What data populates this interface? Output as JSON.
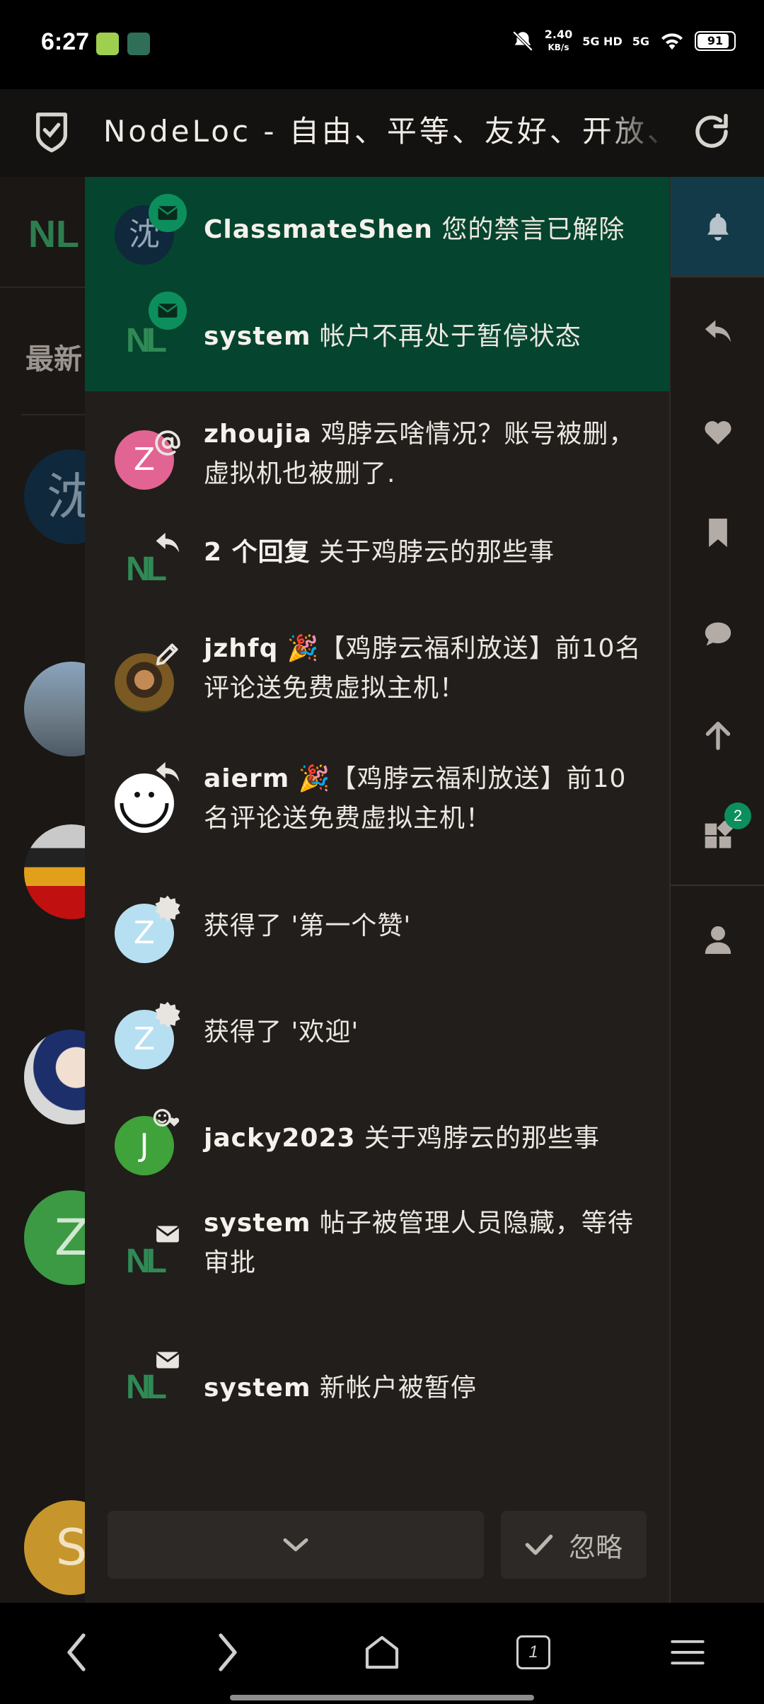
{
  "status_bar": {
    "time": "6:27",
    "speed_value": "2.40",
    "speed_unit": "KB/s",
    "net1": "5G HD",
    "net2": "5G",
    "battery": "91"
  },
  "browser": {
    "title": "NodeLoc - 自由、平等、友好、开放、有爱的社区"
  },
  "background_page": {
    "logo": "NL",
    "latest_label": "最新",
    "avatar_letters": [
      "沈",
      "Z",
      "S"
    ]
  },
  "notifications": [
    {
      "user": "ClassmateShen",
      "text": "您的禁言已解除",
      "kind": "envelope-icon",
      "unread": true,
      "avatar": "沈"
    },
    {
      "user": "system",
      "text": "帐户不再处于暂停状态",
      "kind": "envelope-icon",
      "unread": true,
      "avatar": "NL"
    },
    {
      "user": "zhoujia",
      "text": "鸡脖云啥情况？账号被删，虚拟机也被删了.",
      "kind": "at-icon",
      "unread": false,
      "avatar": "Z"
    },
    {
      "user": "2 个回复",
      "text": "关于鸡脖云的那些事",
      "kind": "reply-icon",
      "unread": false,
      "avatar": "NL"
    },
    {
      "user": "jzhfq",
      "text": "🎉【鸡脖云福利放送】前10名评论送免费虚拟主机！",
      "kind": "pencil-icon",
      "unread": false,
      "avatar": "photo"
    },
    {
      "user": "aierm",
      "text": "🎉【鸡脖云福利放送】前10名评论送免费虚拟主机！",
      "kind": "reply-icon",
      "unread": false,
      "avatar": "a"
    },
    {
      "user": "",
      "text": "获得了 '第一个赞'",
      "kind": "badge-icon",
      "unread": false,
      "avatar": "Z"
    },
    {
      "user": "",
      "text": "获得了 '欢迎'",
      "kind": "badge-icon",
      "unread": false,
      "avatar": "Z"
    },
    {
      "user": "jacky2023",
      "text": "关于鸡脖云的那些事",
      "kind": "like-icon",
      "unread": false,
      "avatar": "J"
    },
    {
      "user": "system",
      "text": "帖子被管理人员隐藏，等待审批",
      "kind": "envelope-icon",
      "unread": false,
      "avatar": "NL"
    },
    {
      "user": "system",
      "text": "新帐户被暂停",
      "kind": "envelope-icon",
      "unread": false,
      "avatar": "NL"
    }
  ],
  "panel_footer": {
    "more_icon": "chevron-down-icon",
    "dismiss_label": "忽略"
  },
  "sidebar": {
    "badge_count": "2",
    "items": [
      "bell-icon",
      "reply-icon",
      "heart-icon",
      "bookmark-icon",
      "chat-icon",
      "arrow-up-icon",
      "widgets-icon",
      "user-icon"
    ]
  },
  "navbar": {
    "tab_count": "1"
  },
  "colors": {
    "unread_bg": "#05442e",
    "accent_green": "#0c8f5d",
    "panel_bg": "#221e1b",
    "active_sidebar": "#133a49"
  }
}
